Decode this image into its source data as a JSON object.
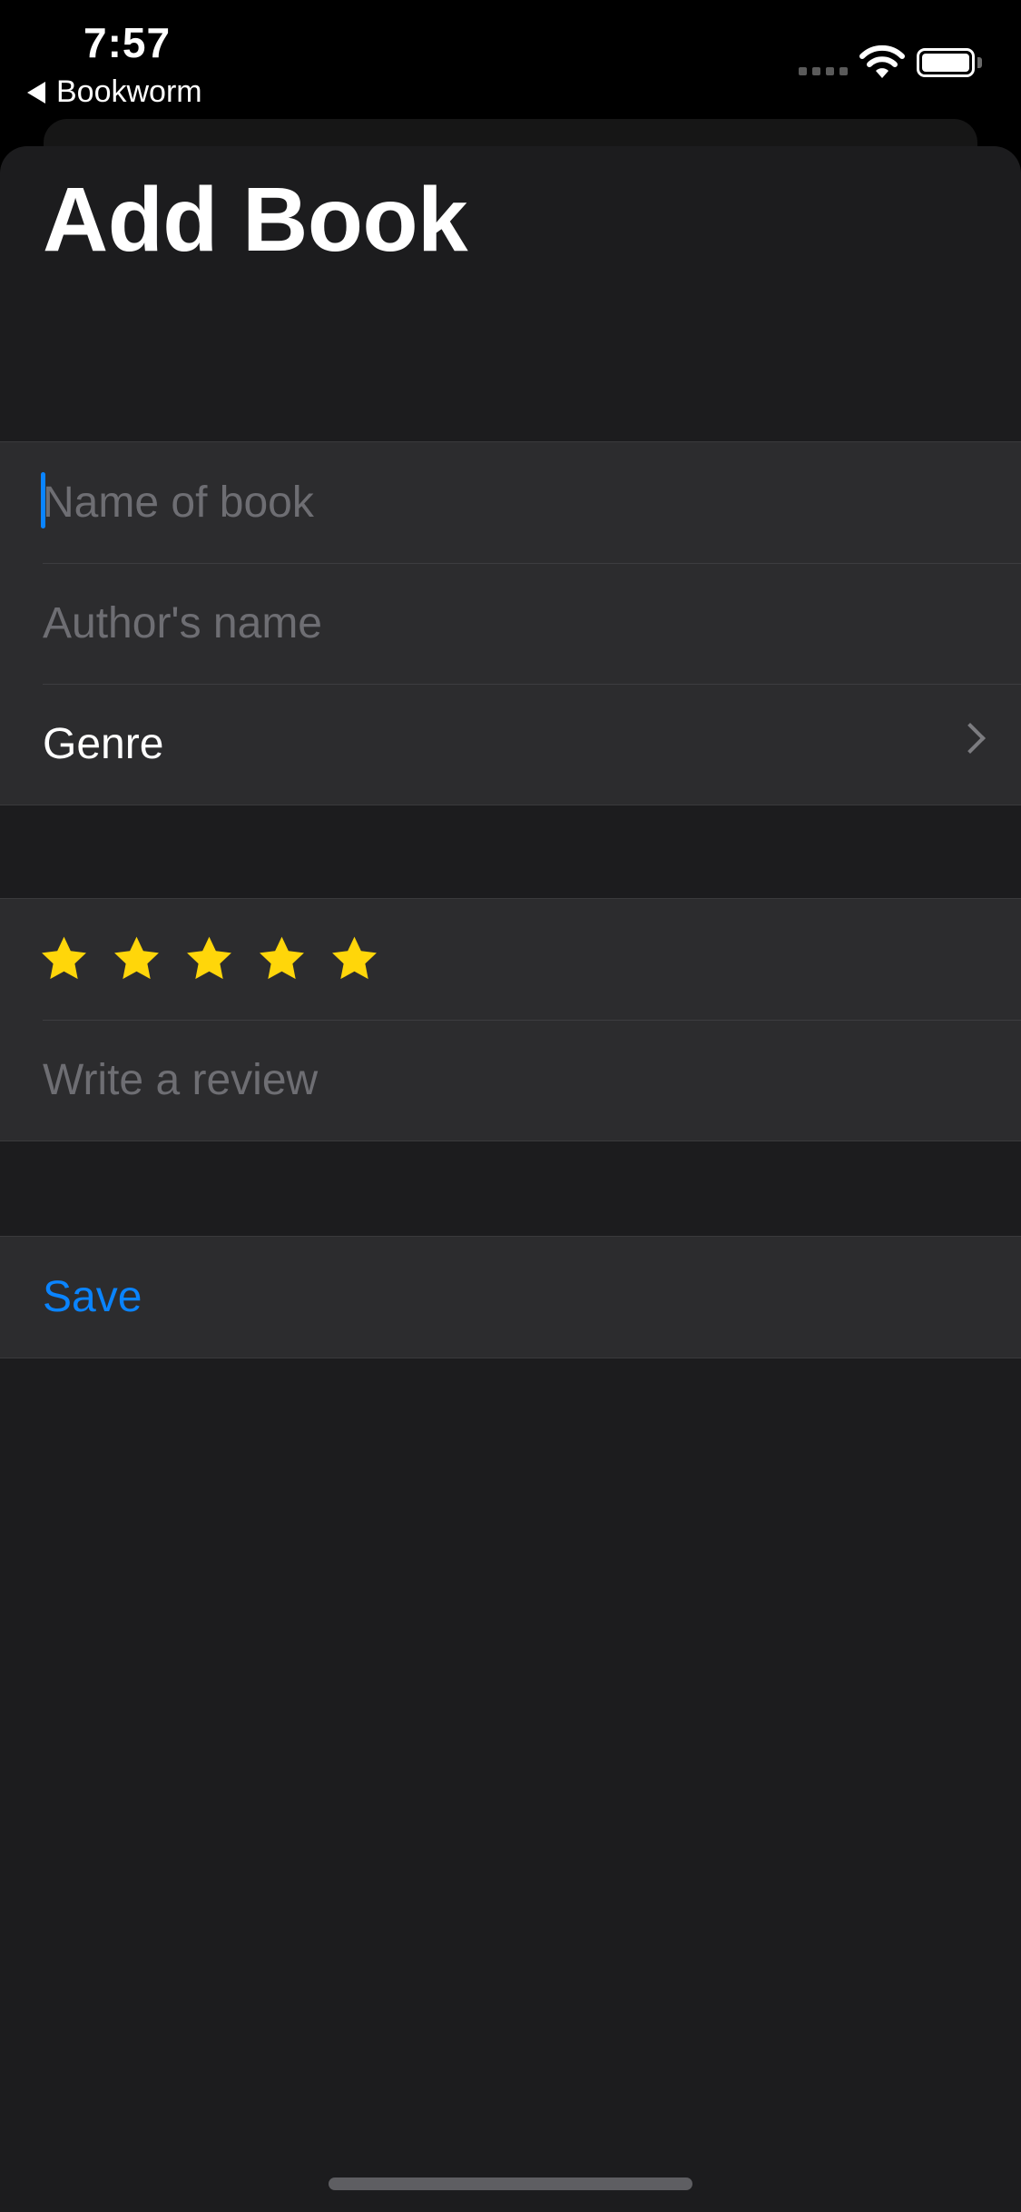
{
  "status_bar": {
    "time": "7:57",
    "back_label": "Bookworm"
  },
  "page": {
    "title": "Add Book"
  },
  "form": {
    "book_name": {
      "placeholder": "Name of book",
      "value": ""
    },
    "author": {
      "placeholder": "Author's name",
      "value": ""
    },
    "genre_label": "Genre",
    "rating": {
      "value": 5,
      "max": 5
    },
    "review": {
      "placeholder": "Write a review",
      "value": ""
    },
    "save_label": "Save"
  },
  "colors": {
    "accent": "#0a84ff",
    "star": "#ffd60a",
    "background": "#1c1c1e",
    "row_background": "#2c2c2e",
    "placeholder": "#6e6e73"
  },
  "icons": {
    "back": "back-triangle-icon",
    "wifi": "wifi-icon",
    "battery": "battery-icon",
    "signal": "cellular-signal-icon",
    "chevron": "chevron-right-icon",
    "star": "star-icon"
  }
}
